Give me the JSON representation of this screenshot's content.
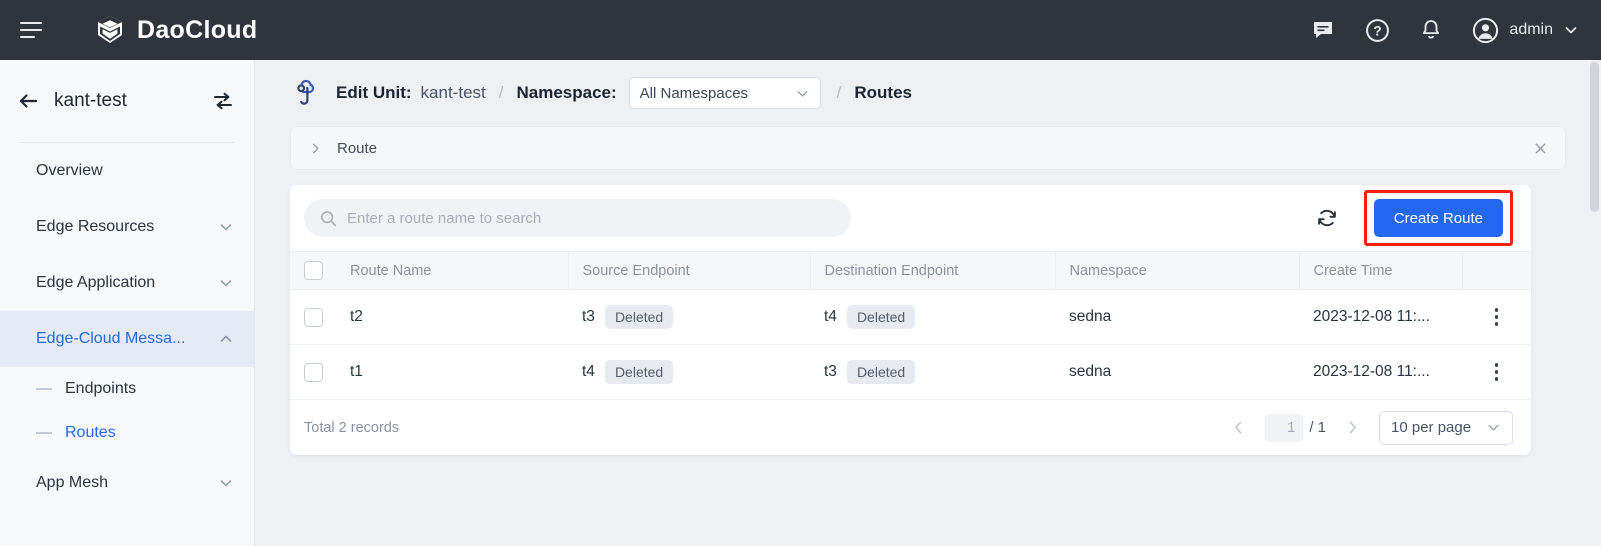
{
  "topbar": {
    "brand": "DaoCloud",
    "menu_icon": "hamburger-icon",
    "logo_icon": "daocloud-cube-logo",
    "icons": [
      "chat-icon",
      "help-icon",
      "bell-icon"
    ],
    "user": "admin",
    "user_chevron": "chevron-down-icon"
  },
  "sidebar": {
    "back_icon": "arrow-left-icon",
    "title": "kant-test",
    "switch_icon": "switch-cluster-icon",
    "items": [
      {
        "label": "Overview",
        "expandable": false,
        "active": false
      },
      {
        "label": "Edge Resources",
        "expandable": true,
        "chevron": "chevron-down-icon",
        "active": false
      },
      {
        "label": "Edge Application",
        "expandable": true,
        "chevron": "chevron-down-icon",
        "active": false
      },
      {
        "label": "Edge-Cloud Messa...",
        "expandable": true,
        "chevron": "chevron-up-icon",
        "active": true
      }
    ],
    "sub_items": [
      {
        "label": "Endpoints",
        "active": false
      },
      {
        "label": "Routes",
        "active": true
      }
    ],
    "items_after": [
      {
        "label": "App Mesh",
        "expandable": true,
        "chevron": "chevron-down-icon",
        "active": false
      }
    ]
  },
  "breadcrumb": {
    "icon": "edit-unit-cloud-icon",
    "edit_unit_label": "Edit Unit:",
    "unit_name": "kant-test",
    "sep1": "/",
    "namespace_label": "Namespace:",
    "namespace_value": "All Namespaces",
    "namespace_chevron": "chevron-down-icon",
    "sep2": "/",
    "page": "Routes"
  },
  "route_panel": {
    "expand_icon": "chevron-right-icon",
    "label": "Route",
    "close_icon": "close-icon"
  },
  "toolbar": {
    "search_placeholder": "Enter a route name to search",
    "search_value": "",
    "search_icon": "search-icon",
    "refresh_icon": "refresh-icon",
    "create_label": "Create Route",
    "highlight_color": "#f5210a",
    "primary_color": "#2468f2"
  },
  "table": {
    "columns": [
      "Route Name",
      "Source Endpoint",
      "Destination Endpoint",
      "Namespace",
      "Create Time"
    ],
    "rows": [
      {
        "name": "t2",
        "source_endpoint": "t3",
        "source_status": "Deleted",
        "destination_endpoint": "t4",
        "destination_status": "Deleted",
        "namespace": "sedna",
        "create_time": "2023-12-08 11:...",
        "actions_icon": "more-vertical-icon"
      },
      {
        "name": "t1",
        "source_endpoint": "t4",
        "source_status": "Deleted",
        "destination_endpoint": "t3",
        "destination_status": "Deleted",
        "namespace": "sedna",
        "create_time": "2023-12-08 11:...",
        "actions_icon": "more-vertical-icon"
      }
    ]
  },
  "footer": {
    "total": "Total 2 records",
    "prev_icon": "chevron-left-icon",
    "next_icon": "chevron-right-icon",
    "current_page": "1",
    "page_divider": "/ 1",
    "per_page": "10 per page",
    "per_page_chevron": "chevron-down-icon"
  }
}
